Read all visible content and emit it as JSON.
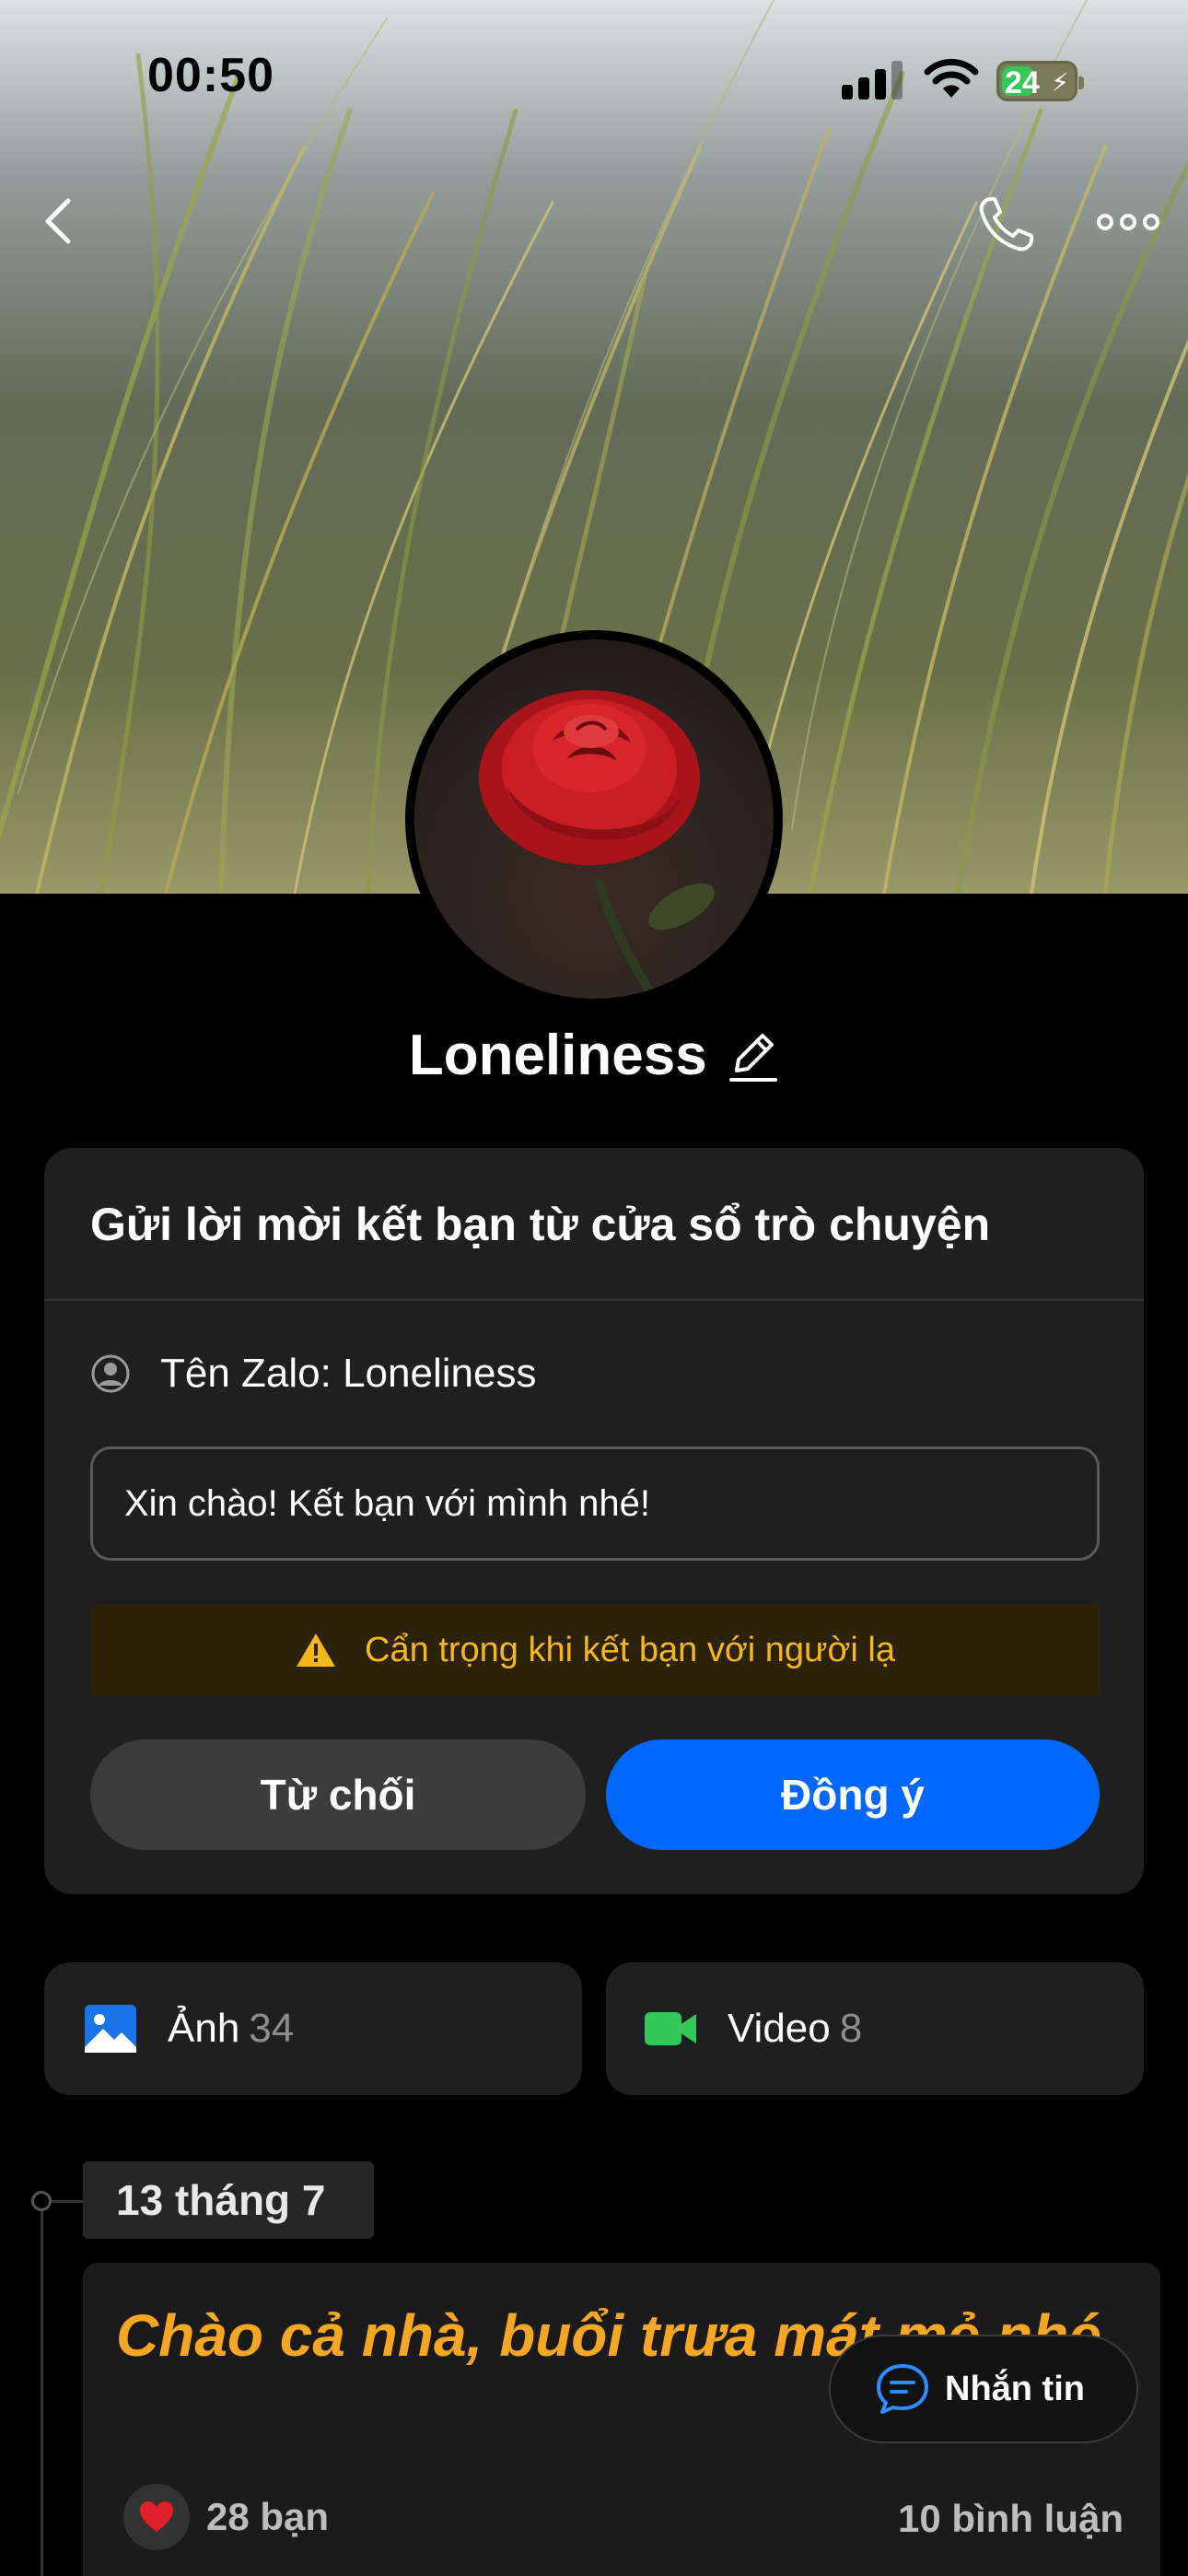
{
  "status_bar": {
    "time": "00:50",
    "battery": "24",
    "icons": [
      "signal-icon",
      "wifi-icon",
      "battery-charging-icon"
    ]
  },
  "nav": {
    "icons": [
      "back-icon",
      "phone-icon",
      "more-icon"
    ]
  },
  "profile": {
    "name": "Loneliness"
  },
  "friend_request": {
    "title": "Gửi lời mời kết bạn từ cửa sổ trò chuyện",
    "zalo_name": "Tên Zalo: Loneliness",
    "message": "Xin chào! Kết bạn với mình nhé!",
    "warning": "Cẩn trọng khi kết bạn với người lạ",
    "decline_label": "Từ chối",
    "accept_label": "Đồng ý"
  },
  "media": {
    "photo_label": "Ảnh",
    "photo_count": "34",
    "video_label": "Video",
    "video_count": "8"
  },
  "timeline": {
    "date": "13 tháng 7",
    "post_text": "Chào cả nhà, buổi trưa mát mẻ nhé",
    "likes": "28 bạn",
    "comments": "10 bình luận"
  },
  "message_button": {
    "label": "Nhắn tin"
  },
  "colors": {
    "accent": "#0068ff",
    "warning": "#f5b818",
    "post_text": "#f5a623",
    "background": "#000000",
    "card": "#1f1f1f"
  }
}
